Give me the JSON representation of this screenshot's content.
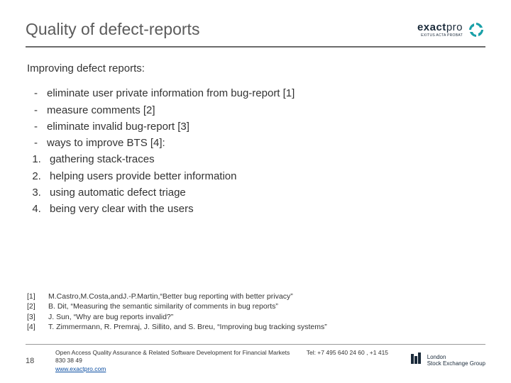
{
  "header": {
    "title": "Quality of defect-reports",
    "logo": {
      "main_bold": "exact",
      "main_light": "pro",
      "sub": "EXITUS ACTA PROBAT"
    }
  },
  "body": {
    "intro": "Improving defect reports:",
    "dash_items": [
      "eliminate user private information from bug-report [1]",
      "measure comments [2]",
      "eliminate invalid bug-report [3]",
      "ways to improve  BTS [4]:"
    ],
    "num_items": [
      "gathering stack-traces",
      "helping users provide better information",
      "using automatic defect triage",
      "being very clear with the users"
    ]
  },
  "refs": [
    {
      "n": "[1]",
      "t": "M.Castro,M.Costa,andJ.-P.Martin,“Better bug reporting with better privacy”"
    },
    {
      "n": "[2]",
      "t": "B. Dit, “Measuring the semantic similarity of comments in bug reports”"
    },
    {
      "n": "[3]",
      "t": "J. Sun, “Why are bug reports invalid?”"
    },
    {
      "n": "[4]",
      "t": "T. Zimmermann, R. Premraj, J. Sillito, and S. Breu, “Improving bug tracking systems”"
    }
  ],
  "footer": {
    "page": "18",
    "line1": "Open Access Quality Assurance & Related Software Development for Financial Markets",
    "tel": "Tel: +7 495 640 24 60 ,  +1 415 830 38 49",
    "link": "www.exactpro.com",
    "lse1": "London",
    "lse2": "Stock Exchange Group"
  }
}
